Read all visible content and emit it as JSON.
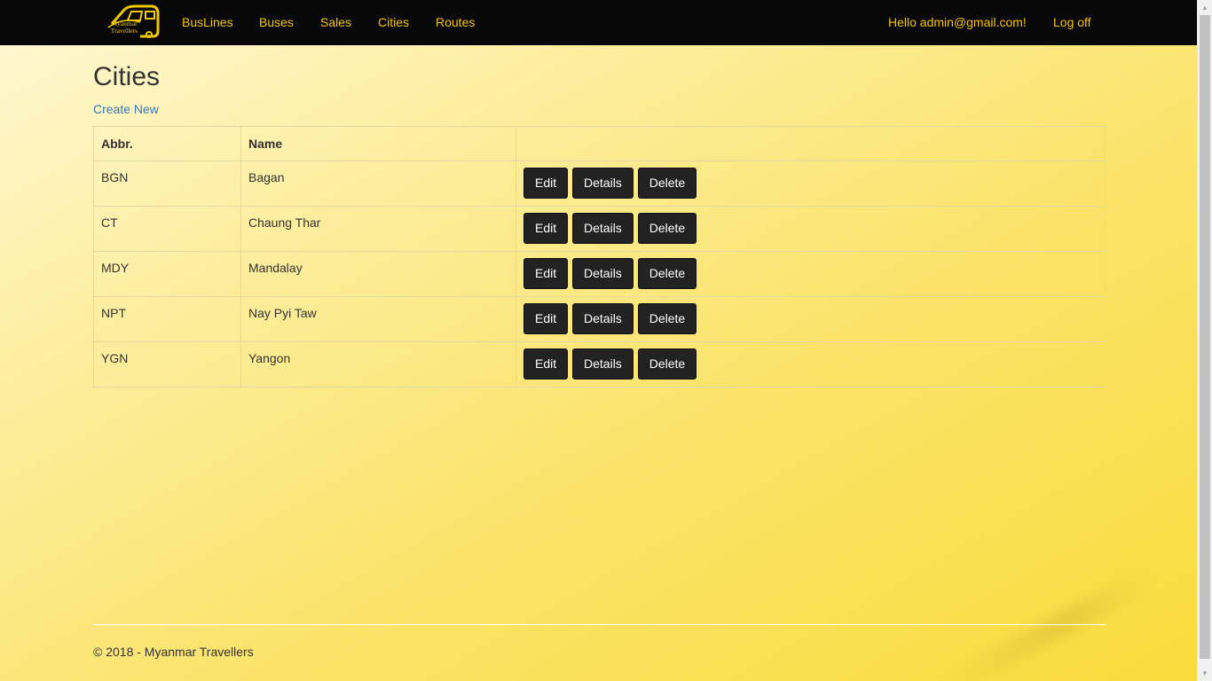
{
  "brand": {
    "logo_text": "Myanmar Travellers",
    "color": "#f5c400"
  },
  "nav": {
    "items": [
      "BusLines",
      "Buses",
      "Sales",
      "Cities",
      "Routes"
    ],
    "greeting": "Hello admin@gmail.com!",
    "logoff": "Log off"
  },
  "page": {
    "title": "Cities",
    "create_link": "Create New"
  },
  "table": {
    "headers": {
      "abbr": "Abbr.",
      "name": "Name"
    },
    "rows": [
      {
        "abbr": "BGN",
        "name": "Bagan"
      },
      {
        "abbr": "CT",
        "name": "Chaung Thar"
      },
      {
        "abbr": "MDY",
        "name": "Mandalay"
      },
      {
        "abbr": "NPT",
        "name": "Nay Pyi Taw"
      },
      {
        "abbr": "YGN",
        "name": "Yangon"
      }
    ],
    "actions": {
      "edit": "Edit",
      "details": "Details",
      "delete": "Delete"
    }
  },
  "footer": {
    "text": "© 2018 - Myanmar Travellers"
  },
  "colors": {
    "navbar": "#080808",
    "accent": "#f5c400",
    "button": "#222222",
    "link": "#337ab7"
  }
}
